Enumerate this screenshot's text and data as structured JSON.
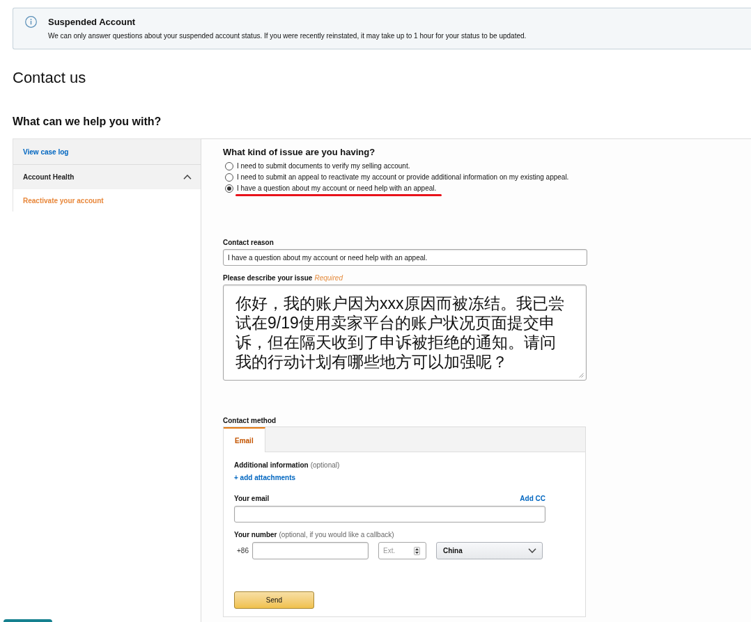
{
  "alert": {
    "title": "Suspended Account",
    "message": "We can only answer questions about your suspended account status. If you were recently reinstated, it may take up to 1 hour for your status to be updated."
  },
  "page_title": "Contact us",
  "section_title": "What can we help you with?",
  "sidebar": {
    "items": [
      {
        "kind": "link",
        "label": "View case log",
        "selected": false
      },
      {
        "kind": "group",
        "label": "Account Health",
        "expanded": true,
        "children": [
          {
            "label": "Reactivate your account",
            "selected": true
          }
        ]
      }
    ]
  },
  "issue_question": {
    "title": "What kind of issue are you having?",
    "options": [
      {
        "label": "I need to submit documents to verify my selling account.",
        "selected": false,
        "highlighted": false
      },
      {
        "label": "I need to submit an appeal to reactivate my account or provide additional information on my existing appeal.",
        "selected": false,
        "highlighted": false
      },
      {
        "label": "I have a question about my account or need help with an appeal.",
        "selected": true,
        "highlighted": true
      }
    ]
  },
  "contact_reason": {
    "label": "Contact reason",
    "value": "I have a question about my account or need help with an appeal."
  },
  "issue_description": {
    "label": "Please describe your issue",
    "required_note": "Required",
    "value": "你好，我的账户因为xxx原因而被冻结。我已尝试在9/19使用卖家平台的账户状况页面提交申诉，但在隔天收到了申诉被拒绝的通知。请问我的行动计划有哪些地方可以加强呢？"
  },
  "contact_method": {
    "label": "Contact method",
    "tabs": [
      {
        "label": "Email",
        "selected": true
      }
    ],
    "additional_info": {
      "label": "Additional information",
      "hint": "(optional)",
      "link": "+ add attachments"
    },
    "email": {
      "label": "Your email",
      "link": "Add CC"
    },
    "phone": {
      "label": "Your number",
      "hint": "(optional, if you would like a callback)",
      "country_code": "+86",
      "ext_placeholder": "Ext.",
      "country": "China"
    },
    "submit": "Send"
  }
}
